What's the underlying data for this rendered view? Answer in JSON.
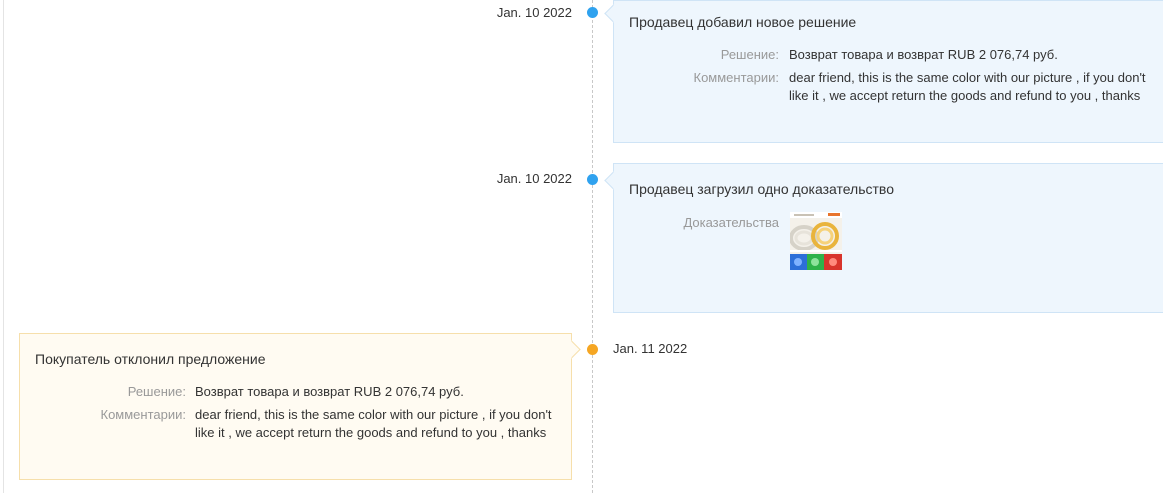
{
  "events": [
    {
      "date": "Jan. 10 2022",
      "title": "Продавец добавил новое решение",
      "rows": [
        {
          "label": "Решение:",
          "value": "Возврат товара и возврат RUB 2 076,74 руб."
        },
        {
          "label": "Комментарии:",
          "value": "dear friend, this is the same color with our picture , if you don't like it , we accept return the goods and refund to you , thanks"
        }
      ]
    },
    {
      "date": "Jan. 10 2022",
      "title": "Продавец загрузил одно доказательство",
      "rows": [
        {
          "label": "Доказательства",
          "value": ""
        }
      ]
    },
    {
      "date": "Jan. 11 2022",
      "title": "Покупатель отклонил предложение",
      "rows": [
        {
          "label": "Решение:",
          "value": "Возврат товара и возврат RUB 2 076,74 руб."
        },
        {
          "label": "Комментарии:",
          "value": "dear friend, this is the same color with our picture , if you don't like it , we accept return the goods and refund to you , thanks"
        }
      ]
    }
  ],
  "colors": {
    "seller_dot": "#2fa2ef",
    "buyer_dot": "#f5a623",
    "seller_card_bg": "#eef6fd",
    "buyer_card_bg": "#fffbf2"
  }
}
